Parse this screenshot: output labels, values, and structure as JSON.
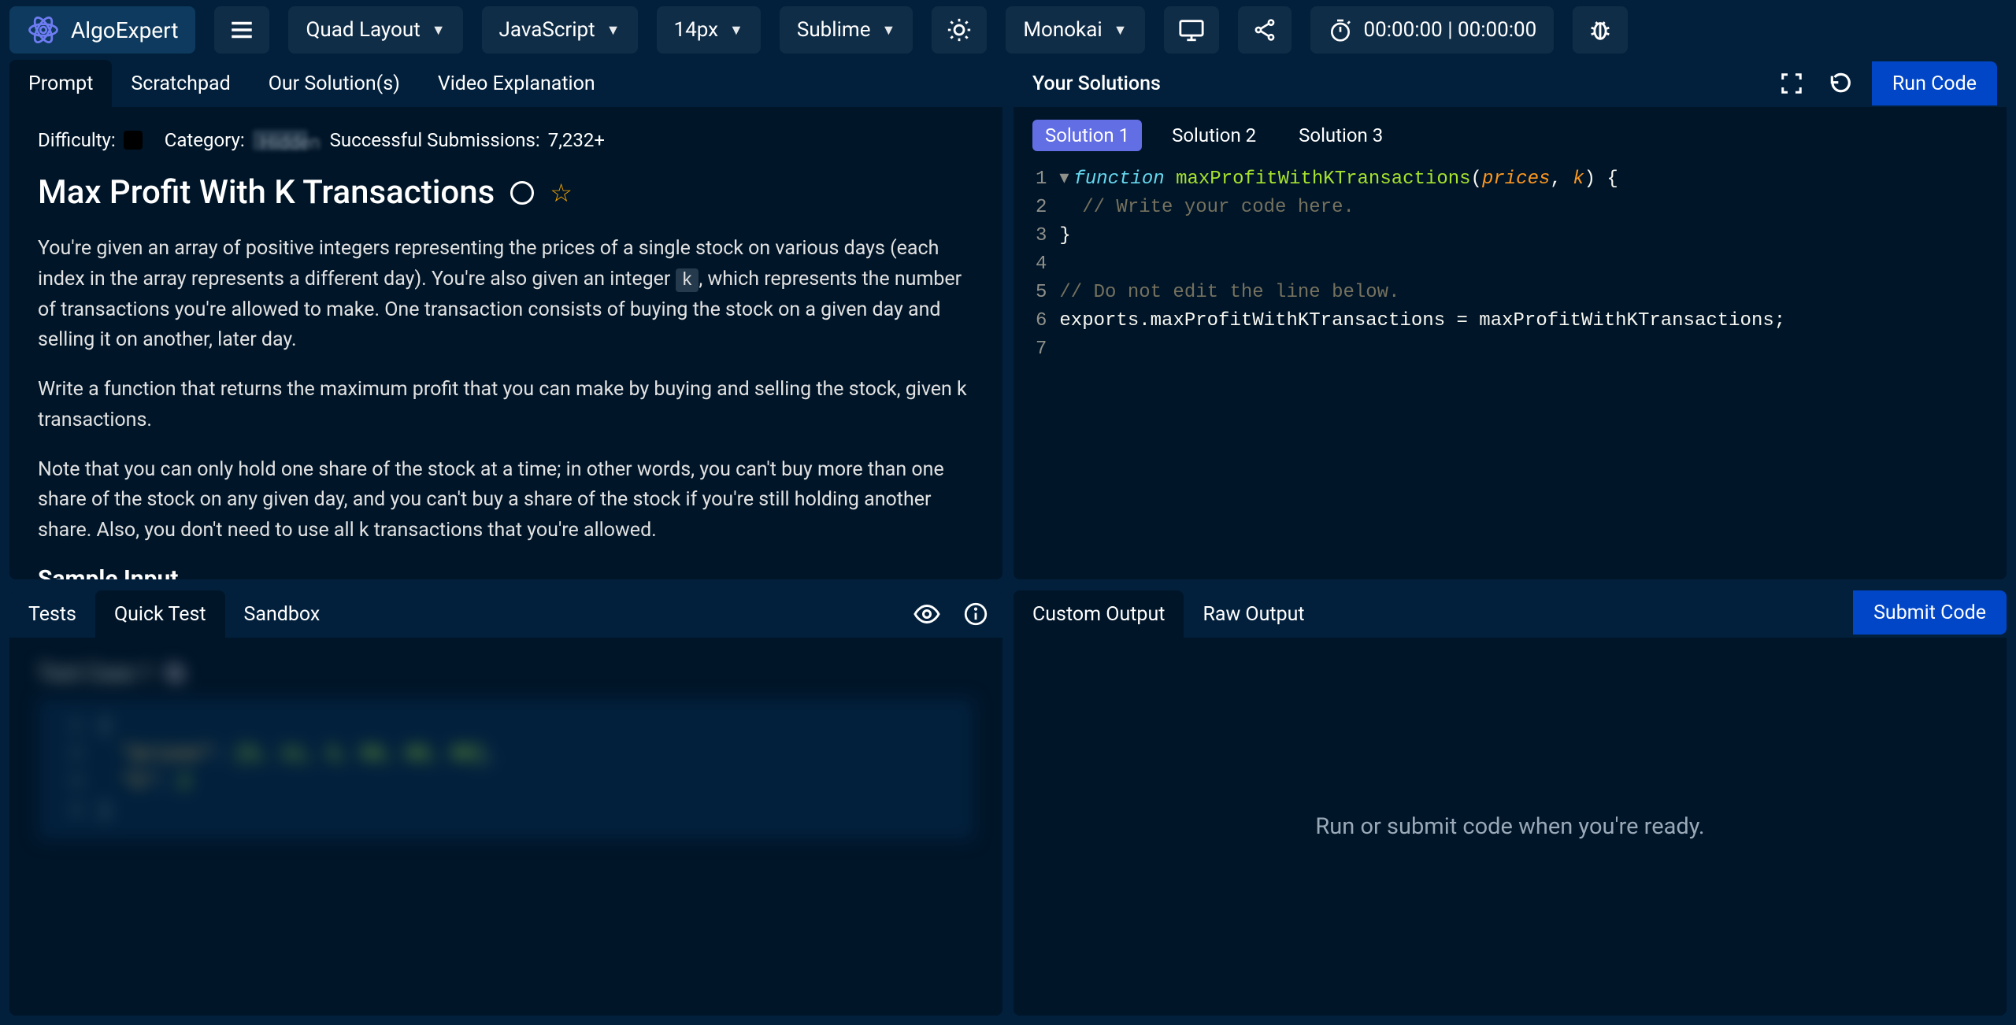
{
  "brand": {
    "name": "AlgoExpert"
  },
  "topbar": {
    "layout": "Quad Layout",
    "language": "JavaScript",
    "font_size": "14px",
    "syntax_theme": "Sublime",
    "editor_theme": "Monokai",
    "timer": "00:00:00 | 00:00:00"
  },
  "prompt_panel": {
    "tabs": {
      "prompt": "Prompt",
      "scratchpad": "Scratchpad",
      "our_solutions": "Our Solution(s)",
      "video": "Video Explanation"
    },
    "meta": {
      "difficulty_label": "Difficulty:",
      "category_label": "Category:",
      "category_value": "Hidden",
      "submissions_label": "Successful Submissions:",
      "submissions_value": "7,232+"
    },
    "title": "Max Profit With K Transactions",
    "p1a": "You're given an array of positive integers representing the prices of a single stock on various days (each index in the array represents a different day). You're also given an integer ",
    "p1_code": "k",
    "p1b": ", which represents the number of transactions you're allowed to make. One transaction consists of buying the stock on a given day and selling it on another, later day.",
    "p2": "Write a function that returns the maximum profit that you can make by buying and selling the stock, given k transactions.",
    "p3": "Note that you can only hold one share of the stock at a time; in other words, you can't buy more than one share of the stock on any given day, and you can't buy a share of the stock if you're still holding another share. Also, you don't need to use all k transactions that you're allowed.",
    "sample_input_h": "Sample Input"
  },
  "solutions_panel": {
    "label": "Your Solutions",
    "run_label": "Run Code",
    "tabs": {
      "s1": "Solution 1",
      "s2": "Solution 2",
      "s3": "Solution 3"
    },
    "code": {
      "fn_kw": "function",
      "fn_name": "maxProfitWithKTransactions",
      "param1": "prices",
      "param2": "k",
      "comment1": "// Write your code here.",
      "comment2": "// Do not edit the line below.",
      "exports": "exports",
      "assign": ".maxProfitWithKTransactions = maxProfitWithKTransactions;"
    }
  },
  "tests_panel": {
    "tabs": {
      "tests": "Tests",
      "quick": "Quick Test",
      "sandbox": "Sandbox"
    },
    "testcase_label": "Test Case 1",
    "json": {
      "prices_key": "\"prices\"",
      "prices_vals": "[5, 11, 3, 50, 60, 90]",
      "k_key": "\"k\"",
      "k_val": "2"
    }
  },
  "output_panel": {
    "tabs": {
      "custom": "Custom Output",
      "raw": "Raw Output"
    },
    "submit_label": "Submit Code",
    "placeholder": "Run or submit code when you're ready."
  }
}
